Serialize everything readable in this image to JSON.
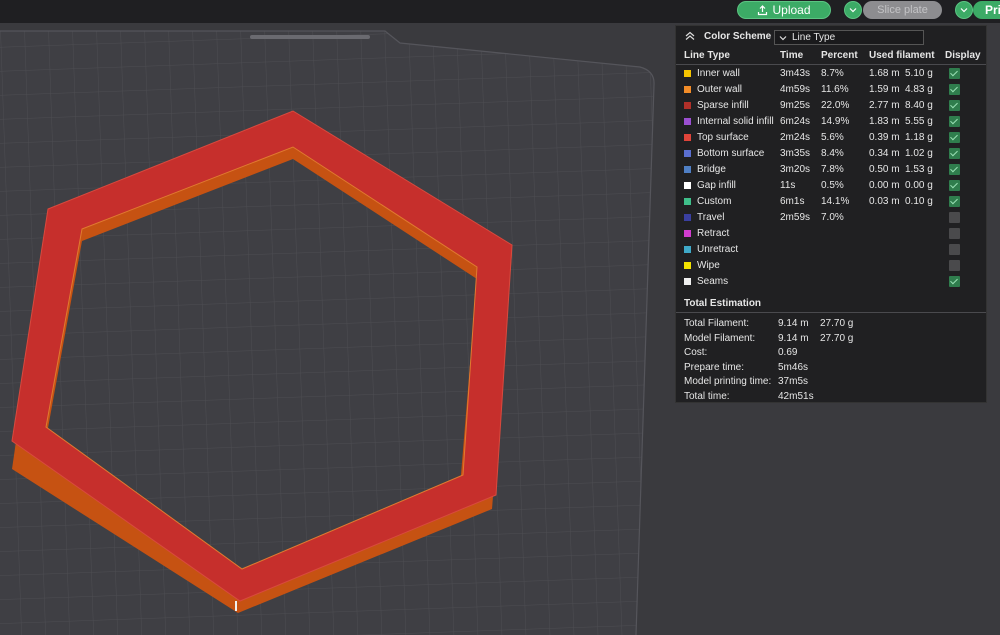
{
  "toolbar": {
    "upload_label": "Upload",
    "slice_label": "Slice plate",
    "print_label": "Pri"
  },
  "colors": {
    "accent": "#3cab66",
    "model_red": "#c62f2c",
    "model_side": "#c65212"
  },
  "legend": {
    "title": "Color Scheme",
    "select_value": "Line Type",
    "columns": [
      "Line Type",
      "Time",
      "Percent",
      "Used filament",
      "Display"
    ],
    "rows": [
      {
        "name": "Inner wall",
        "color": "#f5c400",
        "time": "3m43s",
        "percent": "8.7%",
        "length": "1.68 m",
        "weight": "5.10 g",
        "display": true
      },
      {
        "name": "Outer wall",
        "color": "#f28c28",
        "time": "4m59s",
        "percent": "11.6%",
        "length": "1.59 m",
        "weight": "4.83 g",
        "display": true
      },
      {
        "name": "Sparse infill",
        "color": "#b03029",
        "time": "9m25s",
        "percent": "22.0%",
        "length": "2.77 m",
        "weight": "8.40 g",
        "display": true
      },
      {
        "name": "Internal solid infill",
        "color": "#9b4fd1",
        "time": "6m24s",
        "percent": "14.9%",
        "length": "1.83 m",
        "weight": "5.55 g",
        "display": true
      },
      {
        "name": "Top surface",
        "color": "#e0443a",
        "time": "2m24s",
        "percent": "5.6%",
        "length": "0.39 m",
        "weight": "1.18 g",
        "display": true
      },
      {
        "name": "Bottom surface",
        "color": "#5b6fd0",
        "time": "3m35s",
        "percent": "8.4%",
        "length": "0.34 m",
        "weight": "1.02 g",
        "display": true
      },
      {
        "name": "Bridge",
        "color": "#4f7fc4",
        "time": "3m20s",
        "percent": "7.8%",
        "length": "0.50 m",
        "weight": "1.53 g",
        "display": true
      },
      {
        "name": "Gap infill",
        "color": "#ffffff",
        "time": "11s",
        "percent": "0.5%",
        "length": "0.00 m",
        "weight": "0.00 g",
        "display": true
      },
      {
        "name": "Custom",
        "color": "#3fbf8a",
        "time": "6m1s",
        "percent": "14.1%",
        "length": "0.03 m",
        "weight": "0.10 g",
        "display": true
      },
      {
        "name": "Travel",
        "color": "#3a3fa0",
        "time": "2m59s",
        "percent": "7.0%",
        "length": "",
        "weight": "",
        "display": false
      },
      {
        "name": "Retract",
        "color": "#d13ccf",
        "time": "",
        "percent": "",
        "length": "",
        "weight": "",
        "display": false
      },
      {
        "name": "Unretract",
        "color": "#3fa9c8",
        "time": "",
        "percent": "",
        "length": "",
        "weight": "",
        "display": false
      },
      {
        "name": "Wipe",
        "color": "#f2e200",
        "time": "",
        "percent": "",
        "length": "",
        "weight": "",
        "display": false
      },
      {
        "name": "Seams",
        "color": "#f0f0f0",
        "time": "",
        "percent": "",
        "length": "",
        "weight": "",
        "display": true
      }
    ]
  },
  "estimation": {
    "title": "Total Estimation",
    "rows": [
      {
        "label": "Total Filament:",
        "value": "9.14 m",
        "value2": "27.70 g"
      },
      {
        "label": "Model Filament:",
        "value": "9.14 m",
        "value2": "27.70 g"
      },
      {
        "label": "Cost:",
        "value": "0.69",
        "value2": ""
      },
      {
        "label": "Prepare time:",
        "value": "5m46s",
        "value2": ""
      },
      {
        "label": "Model printing time:",
        "value": "37m5s",
        "value2": ""
      },
      {
        "label": "Total time:",
        "value": "42m51s",
        "value2": ""
      }
    ]
  }
}
